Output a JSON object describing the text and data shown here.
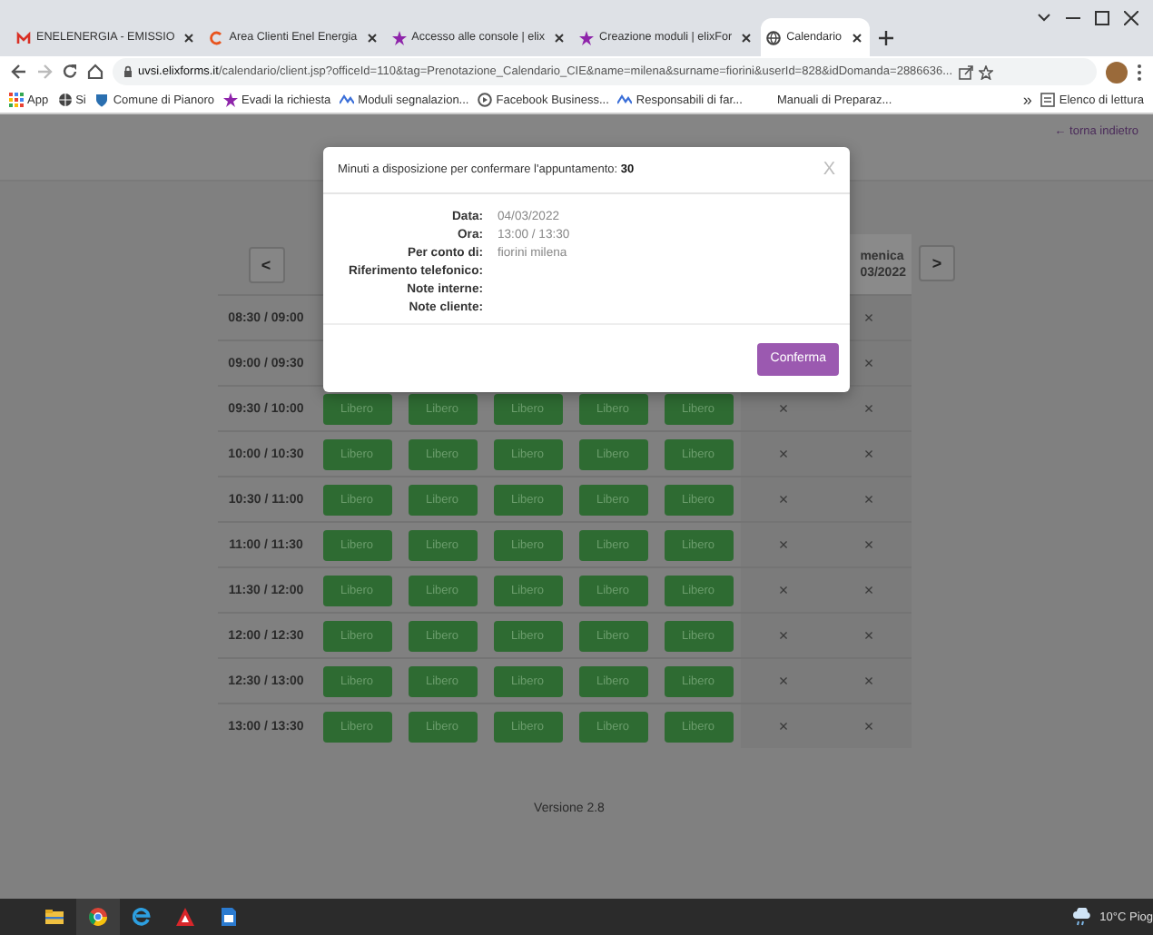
{
  "browser": {
    "tabs": [
      {
        "title": "ENELENERGIA - EMISSIO",
        "selected": false
      },
      {
        "title": "Area Clienti Enel Energia",
        "selected": false
      },
      {
        "title": "Accesso alle console | elix",
        "selected": false
      },
      {
        "title": "Creazione moduli | elixFor",
        "selected": false
      },
      {
        "title": "Calendario",
        "selected": true
      }
    ],
    "url_host": "uvsi.elixforms.it",
    "url_path": "/calendario/client.jsp?officeId=110&tag=Prenotazione_Calendario_CIE&name=milena&surname=fiorini&userId=828&idDomanda=2886636...",
    "bookmarks": [
      "App",
      "Si",
      "Comune di Pianoro",
      "Evadi la richiesta",
      "Moduli segnalazion...",
      "Facebook Business...",
      "Responsabili di far...",
      "Manuali di Preparaz..."
    ],
    "bookmarks_more": "»",
    "reading_list": "Elenco di lettura"
  },
  "page": {
    "back_link": "← torna indietro",
    "prev": "<",
    "next": ">",
    "day_header": [
      "menica",
      "03/2022"
    ],
    "rows": [
      {
        "time": "08:30 / 09:00",
        "slots": [
          {
            "kind": "closed",
            "label": "×"
          }
        ]
      },
      {
        "time": "09:00 / 09:30",
        "slots": [
          {
            "kind": "closed",
            "label": "×"
          }
        ]
      },
      {
        "time": "09:30 / 10:00",
        "slots": [
          {
            "kind": "free",
            "label": "Libero"
          },
          {
            "kind": "free",
            "label": "Libero"
          },
          {
            "kind": "free",
            "label": "Libero"
          },
          {
            "kind": "free",
            "label": "Libero"
          },
          {
            "kind": "free",
            "label": "Libero"
          },
          {
            "kind": "closed",
            "label": "×"
          },
          {
            "kind": "closed",
            "label": "×"
          }
        ]
      },
      {
        "time": "10:00 / 10:30",
        "slots": [
          {
            "kind": "free",
            "label": "Libero"
          },
          {
            "kind": "free",
            "label": "Libero"
          },
          {
            "kind": "free",
            "label": "Libero"
          },
          {
            "kind": "free",
            "label": "Libero"
          },
          {
            "kind": "free",
            "label": "Libero"
          },
          {
            "kind": "closed",
            "label": "×"
          },
          {
            "kind": "closed",
            "label": "×"
          }
        ]
      },
      {
        "time": "10:30 / 11:00",
        "slots": [
          {
            "kind": "free",
            "label": "Libero"
          },
          {
            "kind": "free",
            "label": "Libero"
          },
          {
            "kind": "free",
            "label": "Libero"
          },
          {
            "kind": "free",
            "label": "Libero"
          },
          {
            "kind": "free",
            "label": "Libero"
          },
          {
            "kind": "closed",
            "label": "×"
          },
          {
            "kind": "closed",
            "label": "×"
          }
        ]
      },
      {
        "time": "11:00 / 11:30",
        "slots": [
          {
            "kind": "free",
            "label": "Libero"
          },
          {
            "kind": "free",
            "label": "Libero"
          },
          {
            "kind": "free",
            "label": "Libero"
          },
          {
            "kind": "free",
            "label": "Libero"
          },
          {
            "kind": "free",
            "label": "Libero"
          },
          {
            "kind": "closed",
            "label": "×"
          },
          {
            "kind": "closed",
            "label": "×"
          }
        ]
      },
      {
        "time": "11:30 / 12:00",
        "slots": [
          {
            "kind": "free",
            "label": "Libero"
          },
          {
            "kind": "free",
            "label": "Libero"
          },
          {
            "kind": "free",
            "label": "Libero"
          },
          {
            "kind": "free",
            "label": "Libero"
          },
          {
            "kind": "free",
            "label": "Libero"
          },
          {
            "kind": "closed",
            "label": "×"
          },
          {
            "kind": "closed",
            "label": "×"
          }
        ]
      },
      {
        "time": "12:00 / 12:30",
        "slots": [
          {
            "kind": "free",
            "label": "Libero"
          },
          {
            "kind": "free",
            "label": "Libero"
          },
          {
            "kind": "free",
            "label": "Libero"
          },
          {
            "kind": "free",
            "label": "Libero"
          },
          {
            "kind": "free",
            "label": "Libero"
          },
          {
            "kind": "closed",
            "label": "×"
          },
          {
            "kind": "closed",
            "label": "×"
          }
        ]
      },
      {
        "time": "12:30 / 13:00",
        "slots": [
          {
            "kind": "free",
            "label": "Libero"
          },
          {
            "kind": "free",
            "label": "Libero"
          },
          {
            "kind": "free",
            "label": "Libero"
          },
          {
            "kind": "free",
            "label": "Libero"
          },
          {
            "kind": "free",
            "label": "Libero"
          },
          {
            "kind": "closed",
            "label": "×"
          },
          {
            "kind": "closed",
            "label": "×"
          }
        ]
      },
      {
        "time": "13:00 / 13:30",
        "slots": [
          {
            "kind": "free",
            "label": "Libero"
          },
          {
            "kind": "free",
            "label": "Libero"
          },
          {
            "kind": "free",
            "label": "Libero"
          },
          {
            "kind": "free",
            "label": "Libero"
          },
          {
            "kind": "free",
            "label": "Libero"
          },
          {
            "kind": "closed",
            "label": "×"
          },
          {
            "kind": "closed",
            "label": "×"
          }
        ]
      }
    ],
    "version": "Versione 2.8"
  },
  "modal": {
    "title": "Minuti a disposizione per confermare l'appuntamento: **30**",
    "close": "X",
    "fields": [
      {
        "label": "Data:",
        "value": "04/03/2022"
      },
      {
        "label": "Ora:",
        "value": "13:00 / 13:30"
      },
      {
        "label": "Per conto di:",
        "value": "fiorini milena"
      },
      {
        "label": "Riferimento telefonico:"
      },
      {
        "label": "Note interne:"
      },
      {
        "label": "Note cliente:"
      }
    ],
    "confirm": "Conferma"
  },
  "taskbar": {
    "weather": "10°C Piog"
  }
}
